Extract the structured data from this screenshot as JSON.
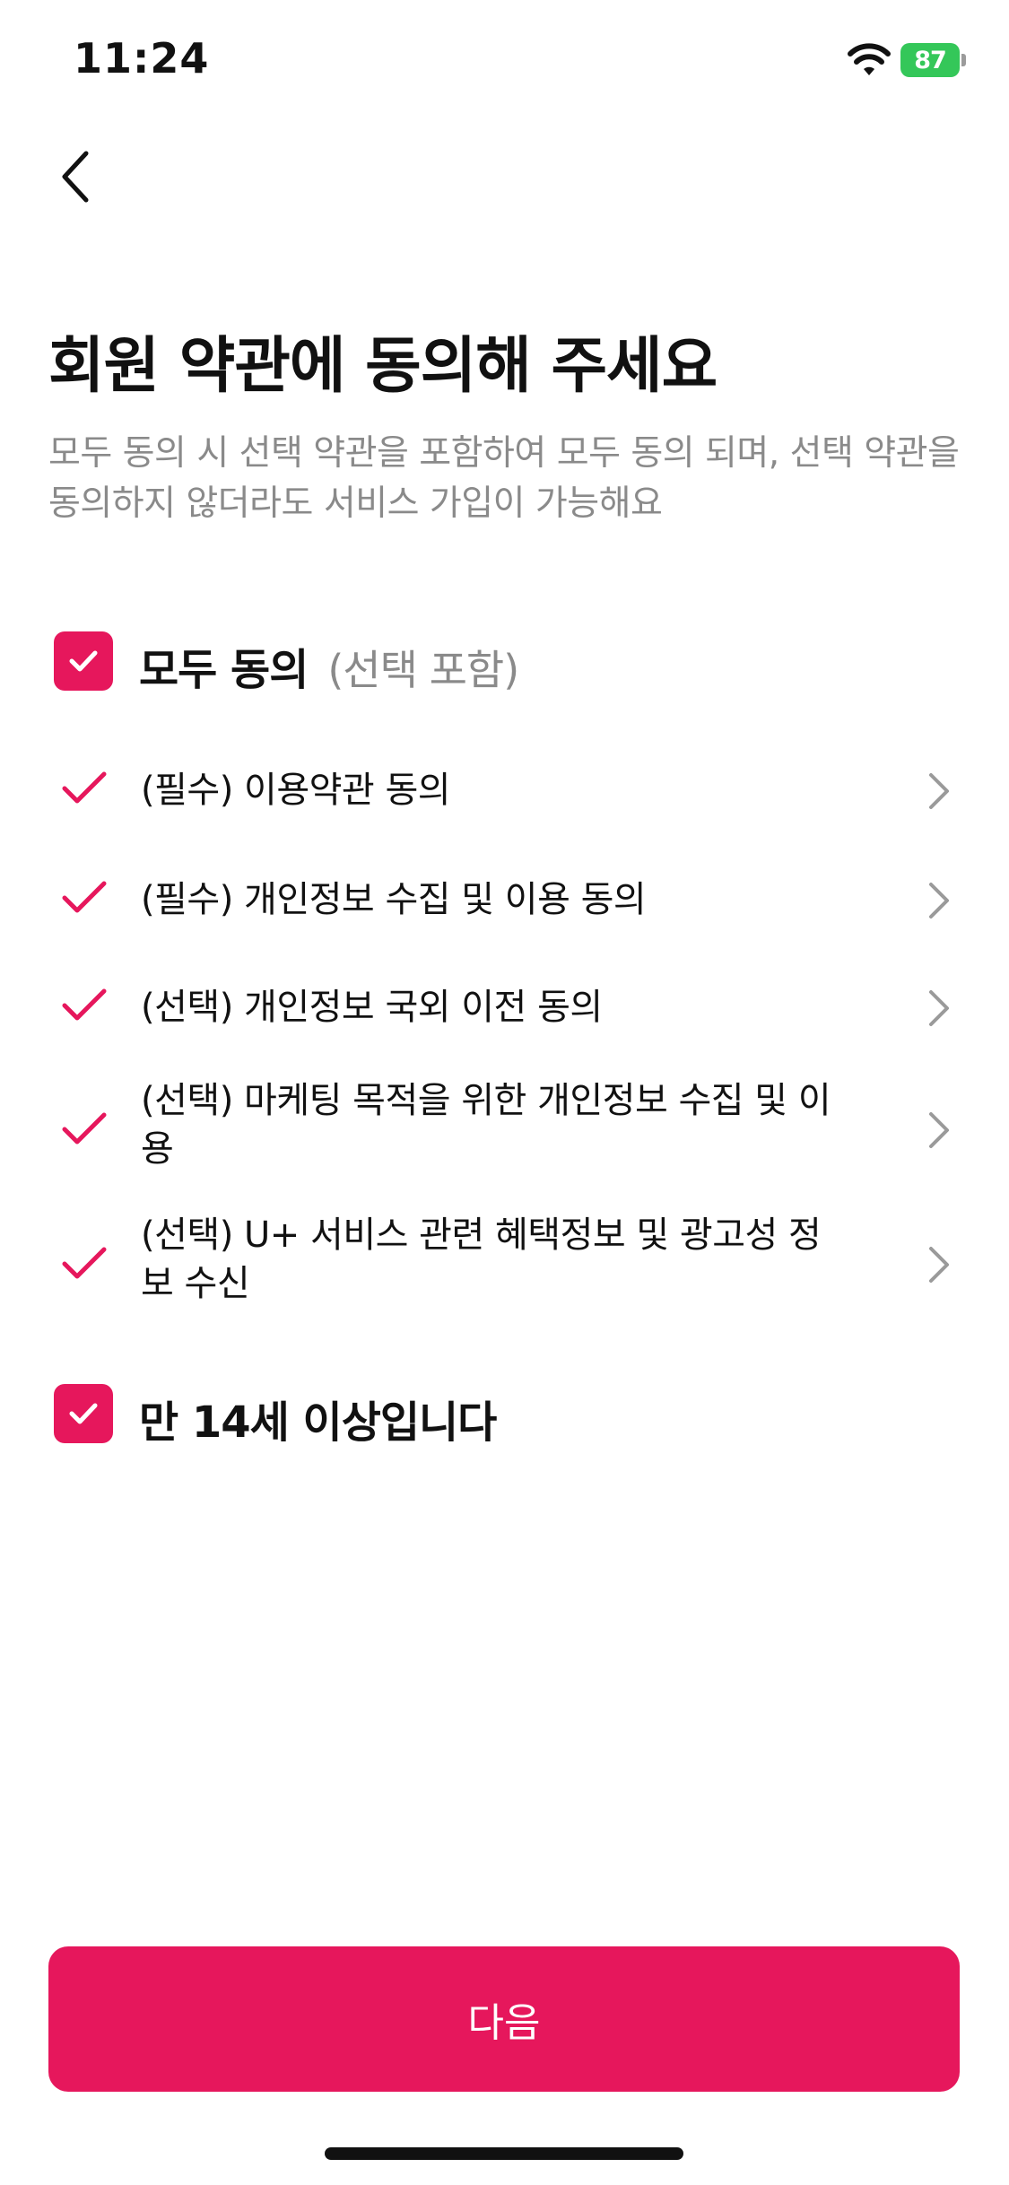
{
  "status_bar": {
    "time": "11:24",
    "battery": "87",
    "wifi_icon": "wifi-icon",
    "battery_color": "#34c759"
  },
  "header": {
    "back_icon": "chevron-left-icon"
  },
  "title": "회원 약관에 동의해 주세요",
  "description": "모두 동의 시 선택 약관을 포함하여 모두 동의 되며, 선택 약관을 동의하지 않더라도 서비스 가입이 가능해요",
  "agree_all": {
    "label": "모두 동의",
    "sub_label": "(선택 포함)",
    "checked": true
  },
  "terms": [
    {
      "label": "(필수) 이용약관 동의",
      "checked": true
    },
    {
      "label": "(필수) 개인정보 수집 및 이용 동의",
      "checked": true
    },
    {
      "label": "(선택) 개인정보 국외 이전 동의",
      "checked": true
    },
    {
      "label": "(선택) 마케팅 목적을 위한 개인정보 수집 및 이용",
      "checked": true
    },
    {
      "label": "(선택) U+ 서비스 관련 혜택정보 및 광고성 정보 수신",
      "checked": true
    }
  ],
  "age_confirm": {
    "label": "만 14세 이상입니다",
    "checked": true
  },
  "next_button": {
    "label": "다음"
  },
  "colors": {
    "accent": "#e6175c",
    "text_primary": "#111111",
    "text_secondary": "#8a8a8a",
    "chevron": "#9a9a9a"
  }
}
